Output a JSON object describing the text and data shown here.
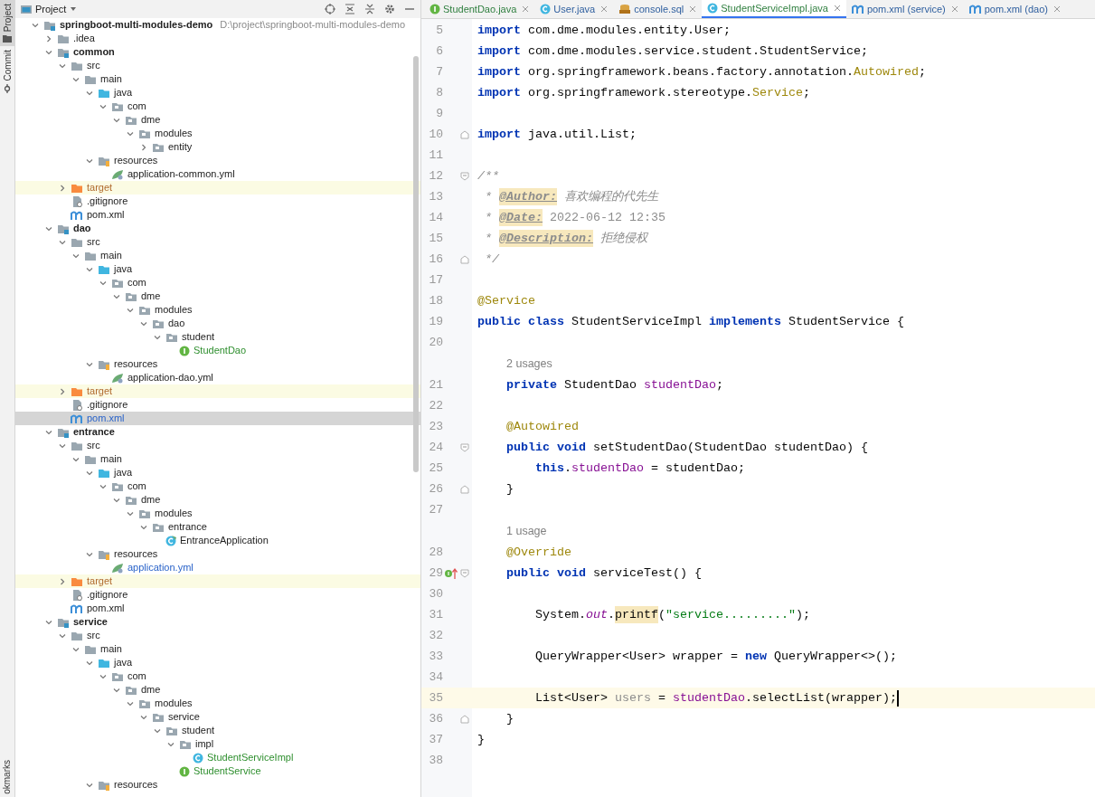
{
  "left_stripe": [
    {
      "label": "Project",
      "selected": true,
      "kind": "folder"
    },
    {
      "label": "Commit",
      "selected": false,
      "kind": "commit"
    }
  ],
  "left_stripe_bottom": {
    "label": "okmarks"
  },
  "project_panel": {
    "title": "Project",
    "tree": [
      {
        "label": "springboot-multi-modules-demo",
        "path": "D:\\project\\springboot-multi-modules-demo",
        "kind": "module",
        "expanded": true,
        "selected": false,
        "children": [
          {
            "label": ".idea",
            "kind": "folder",
            "expanded": false,
            "selected": false
          },
          {
            "label": "common",
            "kind": "module",
            "expanded": true,
            "selected": false,
            "children": [
              {
                "label": "src",
                "kind": "folder",
                "expanded": true,
                "selected": false,
                "children": [
                  {
                    "label": "main",
                    "kind": "folder",
                    "expanded": true,
                    "selected": false,
                    "children": [
                      {
                        "label": "java",
                        "kind": "source",
                        "expanded": true,
                        "selected": false,
                        "children": [
                          {
                            "label": "com",
                            "kind": "package",
                            "expanded": true,
                            "selected": false,
                            "children": [
                              {
                                "label": "dme",
                                "kind": "package",
                                "expanded": true,
                                "selected": false,
                                "children": [
                                  {
                                    "label": "modules",
                                    "kind": "package",
                                    "expanded": true,
                                    "selected": false,
                                    "children": [
                                      {
                                        "label": "entity",
                                        "kind": "package",
                                        "expanded": false,
                                        "selected": false
                                      }
                                    ]
                                  }
                                ]
                              }
                            ]
                          }
                        ]
                      },
                      {
                        "label": "resources",
                        "kind": "resources",
                        "expanded": true,
                        "selected": false,
                        "children": [
                          {
                            "label": "application-common.yml",
                            "kind": "yml",
                            "selected": false
                          }
                        ]
                      }
                    ]
                  }
                ]
              },
              {
                "label": "target",
                "kind": "excluded",
                "expanded": false,
                "selected": false
              },
              {
                "label": ".gitignore",
                "kind": "git",
                "selected": false
              },
              {
                "label": "pom.xml",
                "kind": "maven",
                "selected": false
              }
            ]
          },
          {
            "label": "dao",
            "kind": "module",
            "expanded": true,
            "selected": false,
            "children": [
              {
                "label": "src",
                "kind": "folder",
                "expanded": true,
                "selected": false,
                "children": [
                  {
                    "label": "main",
                    "kind": "folder",
                    "expanded": true,
                    "selected": false,
                    "children": [
                      {
                        "label": "java",
                        "kind": "source",
                        "expanded": true,
                        "selected": false,
                        "children": [
                          {
                            "label": "com",
                            "kind": "package",
                            "expanded": true,
                            "selected": false,
                            "children": [
                              {
                                "label": "dme",
                                "kind": "package",
                                "expanded": true,
                                "selected": false,
                                "children": [
                                  {
                                    "label": "modules",
                                    "kind": "package",
                                    "expanded": true,
                                    "selected": false,
                                    "children": [
                                      {
                                        "label": "dao",
                                        "kind": "package",
                                        "expanded": true,
                                        "selected": false,
                                        "children": [
                                          {
                                            "label": "student",
                                            "kind": "package",
                                            "expanded": true,
                                            "selected": false,
                                            "children": [
                                              {
                                                "label": "StudentDao",
                                                "kind": "interface",
                                                "color": "#2f8f2f",
                                                "selected": false
                                              }
                                            ]
                                          }
                                        ]
                                      }
                                    ]
                                  }
                                ]
                              }
                            ]
                          }
                        ]
                      },
                      {
                        "label": "resources",
                        "kind": "resources",
                        "expanded": true,
                        "selected": false,
                        "children": [
                          {
                            "label": "application-dao.yml",
                            "kind": "yml",
                            "selected": false
                          }
                        ]
                      }
                    ]
                  }
                ]
              },
              {
                "label": "target",
                "kind": "excluded",
                "expanded": false,
                "selected": false
              },
              {
                "label": ".gitignore",
                "kind": "git",
                "selected": false
              },
              {
                "label": "pom.xml",
                "kind": "maven",
                "color": "#2a63c9",
                "selected": true
              }
            ]
          },
          {
            "label": "entrance",
            "kind": "module",
            "expanded": true,
            "selected": false,
            "children": [
              {
                "label": "src",
                "kind": "folder",
                "expanded": true,
                "selected": false,
                "children": [
                  {
                    "label": "main",
                    "kind": "folder",
                    "expanded": true,
                    "selected": false,
                    "children": [
                      {
                        "label": "java",
                        "kind": "source",
                        "expanded": true,
                        "selected": false,
                        "children": [
                          {
                            "label": "com",
                            "kind": "package",
                            "expanded": true,
                            "selected": false,
                            "children": [
                              {
                                "label": "dme",
                                "kind": "package",
                                "expanded": true,
                                "selected": false,
                                "children": [
                                  {
                                    "label": "modules",
                                    "kind": "package",
                                    "expanded": true,
                                    "selected": false,
                                    "children": [
                                      {
                                        "label": "entrance",
                                        "kind": "package",
                                        "expanded": true,
                                        "selected": false,
                                        "children": [
                                          {
                                            "label": "EntranceApplication",
                                            "kind": "spring",
                                            "selected": false
                                          }
                                        ]
                                      }
                                    ]
                                  }
                                ]
                              }
                            ]
                          }
                        ]
                      },
                      {
                        "label": "resources",
                        "kind": "resources",
                        "expanded": true,
                        "selected": false,
                        "children": [
                          {
                            "label": "application.yml",
                            "kind": "yml",
                            "color": "#2a63c9",
                            "selected": false
                          }
                        ]
                      }
                    ]
                  }
                ]
              },
              {
                "label": "target",
                "kind": "excluded",
                "expanded": false,
                "selected": false
              },
              {
                "label": ".gitignore",
                "kind": "git",
                "selected": false
              },
              {
                "label": "pom.xml",
                "kind": "maven",
                "selected": false
              }
            ]
          },
          {
            "label": "service",
            "kind": "module",
            "expanded": true,
            "selected": false,
            "children": [
              {
                "label": "src",
                "kind": "folder",
                "expanded": true,
                "selected": false,
                "children": [
                  {
                    "label": "main",
                    "kind": "folder",
                    "expanded": true,
                    "selected": false,
                    "children": [
                      {
                        "label": "java",
                        "kind": "source",
                        "expanded": true,
                        "selected": false,
                        "children": [
                          {
                            "label": "com",
                            "kind": "package",
                            "expanded": true,
                            "selected": false,
                            "children": [
                              {
                                "label": "dme",
                                "kind": "package",
                                "expanded": true,
                                "selected": false,
                                "children": [
                                  {
                                    "label": "modules",
                                    "kind": "package",
                                    "expanded": true,
                                    "selected": false,
                                    "children": [
                                      {
                                        "label": "service",
                                        "kind": "package",
                                        "expanded": true,
                                        "selected": false,
                                        "children": [
                                          {
                                            "label": "student",
                                            "kind": "package",
                                            "expanded": true,
                                            "selected": false,
                                            "children": [
                                              {
                                                "label": "impl",
                                                "kind": "package",
                                                "expanded": true,
                                                "selected": false,
                                                "children": [
                                                  {
                                                    "label": "StudentServiceImpl",
                                                    "kind": "class",
                                                    "color": "#2f8f2f",
                                                    "selected": false
                                                  }
                                                ]
                                              },
                                              {
                                                "label": "StudentService",
                                                "kind": "interface",
                                                "color": "#2f8f2f",
                                                "selected": false
                                              }
                                            ]
                                          }
                                        ]
                                      }
                                    ]
                                  }
                                ]
                              }
                            ]
                          }
                        ]
                      },
                      {
                        "label": "resources",
                        "kind": "resources",
                        "expanded": true,
                        "selected": false
                      }
                    ]
                  }
                ]
              }
            ]
          }
        ]
      }
    ]
  },
  "tabs": [
    {
      "label": "StudentDao.java",
      "kind": "interface",
      "selected": false
    },
    {
      "label": "User.java",
      "kind": "class",
      "selected": false
    },
    {
      "label": "console.sql",
      "kind": "sql",
      "selected": false
    },
    {
      "label": "StudentServiceImpl.java",
      "kind": "class",
      "selected": true
    },
    {
      "label": "pom.xml (service)",
      "kind": "maven",
      "selected": false
    },
    {
      "label": "pom.xml (dao)",
      "kind": "maven",
      "selected": false
    }
  ],
  "editor": {
    "lines": [
      {
        "number": "5",
        "tokens": [
          {
            "kind": "keyword",
            "text": "import"
          },
          {
            "kind": "plain",
            "text": " com.dme.modules.entity.User;"
          }
        ]
      },
      {
        "number": "6",
        "tokens": [
          {
            "kind": "keyword",
            "text": "import"
          },
          {
            "kind": "plain",
            "text": " com.dme.modules.service.student.StudentService;"
          }
        ]
      },
      {
        "number": "7",
        "tokens": [
          {
            "kind": "keyword",
            "text": "import"
          },
          {
            "kind": "plain",
            "text": " org.springframework.beans.factory.annotation."
          },
          {
            "kind": "annotation",
            "text": "Autowired"
          },
          {
            "kind": "plain",
            "text": ";"
          }
        ]
      },
      {
        "number": "8",
        "tokens": [
          {
            "kind": "keyword",
            "text": "import"
          },
          {
            "kind": "plain",
            "text": " org.springframework.stereotype."
          },
          {
            "kind": "annotation",
            "text": "Service"
          },
          {
            "kind": "plain",
            "text": ";"
          }
        ]
      },
      {
        "number": "9"
      },
      {
        "number": "10",
        "fold_end": true,
        "tokens": [
          {
            "kind": "keyword",
            "text": "import"
          },
          {
            "kind": "plain",
            "text": " java.util.List;"
          }
        ]
      },
      {
        "number": "11"
      },
      {
        "number": "12",
        "fold_start": true,
        "tokens": [
          {
            "kind": "comment",
            "text": "/**"
          }
        ]
      },
      {
        "number": "13",
        "tokens": [
          {
            "kind": "comment",
            "text": " * "
          },
          {
            "kind": "doc_tag",
            "text": "@Author:"
          },
          {
            "kind": "comment",
            "text": " 喜欢编程的代先生"
          }
        ]
      },
      {
        "number": "14",
        "tokens": [
          {
            "kind": "comment",
            "text": " * "
          },
          {
            "kind": "doc_tag",
            "text": "@Date:"
          },
          {
            "kind": "doc_value",
            "text": " 2022-06-12 12:35"
          }
        ]
      },
      {
        "number": "15",
        "tokens": [
          {
            "kind": "comment",
            "text": " * "
          },
          {
            "kind": "doc_tag",
            "text": "@Description:"
          },
          {
            "kind": "comment",
            "text": " 拒绝侵权"
          }
        ]
      },
      {
        "number": "16",
        "fold_end": true,
        "tokens": [
          {
            "kind": "comment",
            "text": " */"
          }
        ]
      },
      {
        "number": "17"
      },
      {
        "number": "18",
        "tokens": [
          {
            "kind": "annotation",
            "text": "@Service"
          }
        ]
      },
      {
        "number": "19",
        "tokens": [
          {
            "kind": "keyword",
            "text": "public class"
          },
          {
            "kind": "plain",
            "text": " StudentServiceImpl "
          },
          {
            "kind": "keyword",
            "text": "implements"
          },
          {
            "kind": "plain",
            "text": " StudentService {"
          }
        ]
      },
      {
        "number": "20"
      },
      {
        "kind": "inlay",
        "text": "2 usages"
      },
      {
        "number": "21",
        "tokens": [
          {
            "kind": "keyword",
            "text": "    private"
          },
          {
            "kind": "plain",
            "text": " StudentDao "
          },
          {
            "kind": "field",
            "text": "studentDao"
          },
          {
            "kind": "plain",
            "text": ";"
          }
        ]
      },
      {
        "number": "22"
      },
      {
        "number": "23",
        "tokens": [
          {
            "kind": "annotation",
            "text": "    @Autowired"
          }
        ]
      },
      {
        "number": "24",
        "fold_start": true,
        "tokens": [
          {
            "kind": "keyword",
            "text": "    public void"
          },
          {
            "kind": "plain",
            "text": " setStudentDao(StudentDao studentDao) {"
          }
        ]
      },
      {
        "number": "25",
        "tokens": [
          {
            "kind": "keyword",
            "text": "        this"
          },
          {
            "kind": "plain",
            "text": "."
          },
          {
            "kind": "field",
            "text": "studentDao"
          },
          {
            "kind": "plain",
            "text": " = studentDao;"
          }
        ]
      },
      {
        "number": "26",
        "fold_end": true,
        "tokens": [
          {
            "kind": "plain",
            "text": "    }"
          }
        ]
      },
      {
        "number": "27"
      },
      {
        "kind": "inlay",
        "text": "1 usage"
      },
      {
        "number": "28",
        "tokens": [
          {
            "kind": "annotation",
            "text": "    @Override"
          }
        ]
      },
      {
        "number": "29",
        "fold_start": true,
        "implements_marker": true,
        "tokens": [
          {
            "kind": "keyword",
            "text": "    public void"
          },
          {
            "kind": "plain",
            "text": " serviceTest() {"
          }
        ]
      },
      {
        "number": "30"
      },
      {
        "number": "31",
        "tokens": [
          {
            "kind": "plain",
            "text": "        System."
          },
          {
            "kind": "static_field",
            "text": "out"
          },
          {
            "kind": "plain",
            "text": "."
          },
          {
            "kind": "highlight",
            "text": "printf"
          },
          {
            "kind": "plain",
            "text": "("
          },
          {
            "kind": "string",
            "text": "\"service.........\""
          },
          {
            "kind": "plain",
            "text": ");"
          }
        ]
      },
      {
        "number": "32"
      },
      {
        "number": "33",
        "tokens": [
          {
            "kind": "plain",
            "text": "        QueryWrapper<User> wrapper = "
          },
          {
            "kind": "keyword",
            "text": "new"
          },
          {
            "kind": "plain",
            "text": " QueryWrapper<>();"
          }
        ]
      },
      {
        "number": "34"
      },
      {
        "number": "35",
        "current": true,
        "tokens": [
          {
            "kind": "plain",
            "text": "        List<User> "
          },
          {
            "kind": "unused",
            "text": "users"
          },
          {
            "kind": "plain",
            "text": " = "
          },
          {
            "kind": "field",
            "text": "studentDao"
          },
          {
            "kind": "plain",
            "text": ".selectList(wrapper);"
          }
        ]
      },
      {
        "number": "36",
        "fold_end": true,
        "tokens": [
          {
            "kind": "plain",
            "text": "    }"
          }
        ]
      },
      {
        "number": "37",
        "tokens": [
          {
            "kind": "plain",
            "text": "}"
          }
        ]
      },
      {
        "number": "38"
      }
    ]
  }
}
